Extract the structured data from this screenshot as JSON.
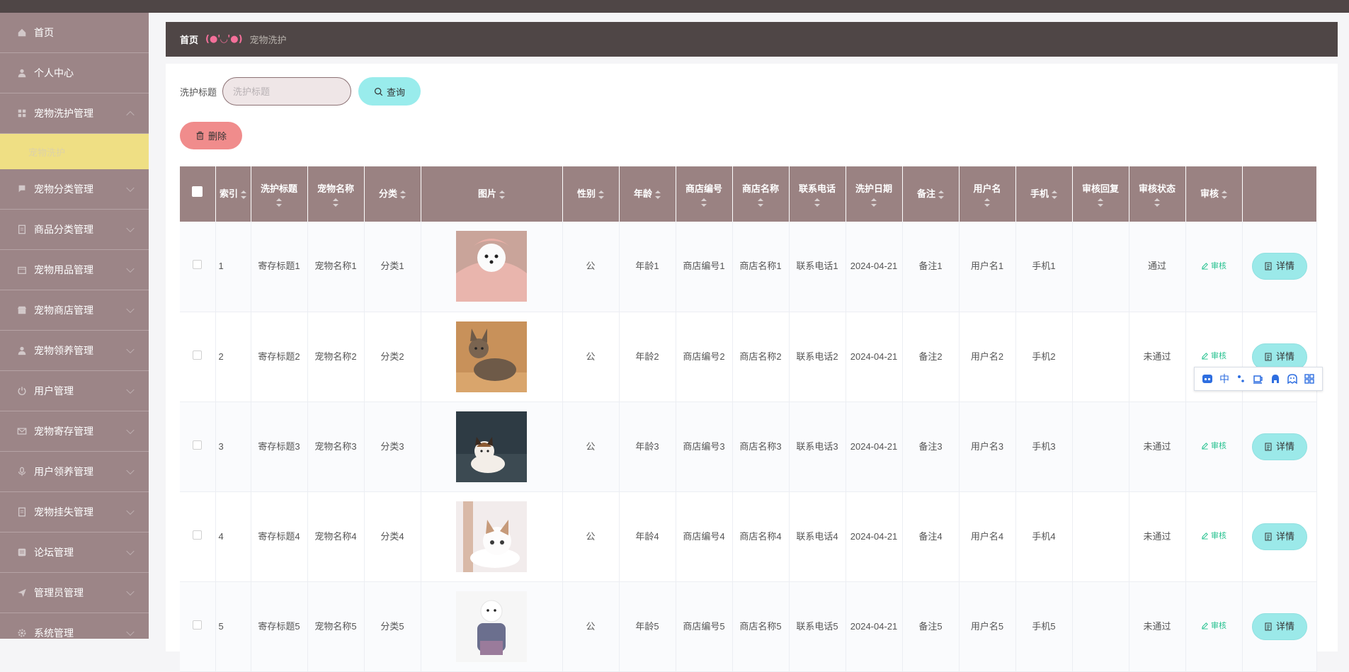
{
  "sidebar": {
    "items": [
      {
        "label": "首页",
        "icon": "home-icon",
        "has_arrow": false
      },
      {
        "label": "个人中心",
        "icon": "user-icon",
        "has_arrow": false
      },
      {
        "label": "宠物洗护管理",
        "icon": "grid-icon",
        "has_arrow": true,
        "expanded": true
      },
      {
        "label": "宠物分类管理",
        "icon": "flag-icon",
        "has_arrow": true
      },
      {
        "label": "商品分类管理",
        "icon": "doc-icon",
        "has_arrow": true
      },
      {
        "label": "宠物用品管理",
        "icon": "box-icon",
        "has_arrow": true
      },
      {
        "label": "宠物商店管理",
        "icon": "shop-icon",
        "has_arrow": true
      },
      {
        "label": "宠物领养管理",
        "icon": "user-icon",
        "has_arrow": true
      },
      {
        "label": "用户管理",
        "icon": "power-icon",
        "has_arrow": true
      },
      {
        "label": "宠物寄存管理",
        "icon": "mail-icon",
        "has_arrow": true
      },
      {
        "label": "用户领养管理",
        "icon": "mic-icon",
        "has_arrow": true
      },
      {
        "label": "宠物挂失管理",
        "icon": "doc-icon",
        "has_arrow": true
      },
      {
        "label": "论坛管理",
        "icon": "list-icon",
        "has_arrow": true
      },
      {
        "label": "管理员管理",
        "icon": "send-icon",
        "has_arrow": true
      },
      {
        "label": "系统管理",
        "icon": "gear-icon",
        "has_arrow": true
      }
    ],
    "active_sub": "宠物洗护"
  },
  "breadcrumb": {
    "home": "首页",
    "separator": "(●'◡'●)",
    "current": "宠物洗护"
  },
  "search": {
    "label": "洗护标题",
    "placeholder": "洗护标题",
    "value": "",
    "button": "查询"
  },
  "actions": {
    "delete": "删除"
  },
  "table": {
    "columns": [
      "索引",
      "洗护标题",
      "宠物名称",
      "分类",
      "图片",
      "性别",
      "年龄",
      "商店编号",
      "商店名称",
      "联系电话",
      "洗护日期",
      "备注",
      "用户名",
      "手机",
      "审核回复",
      "审核状态",
      "审核",
      ""
    ],
    "rows": [
      {
        "index": "1",
        "title": "寄存标题1",
        "pet": "宠物名称1",
        "category": "分类1",
        "image": "white-dog",
        "gender": "公",
        "age": "年龄1",
        "shop_no": "商店编号1",
        "shop_name": "商店名称1",
        "phone": "联系电话1",
        "date": "2024-04-21",
        "note": "备注1",
        "username": "用户名1",
        "mobile": "手机1",
        "reply": "",
        "status": "通过",
        "audit": "审核",
        "detail": "详情"
      },
      {
        "index": "2",
        "title": "寄存标题2",
        "pet": "宠物名称2",
        "category": "分类2",
        "image": "tabby-cat",
        "gender": "公",
        "age": "年龄2",
        "shop_no": "商店编号2",
        "shop_name": "商店名称2",
        "phone": "联系电话2",
        "date": "2024-04-21",
        "note": "备注2",
        "username": "用户名2",
        "mobile": "手机2",
        "reply": "",
        "status": "未通过",
        "audit": "审核",
        "detail": "详情"
      },
      {
        "index": "3",
        "title": "寄存标题3",
        "pet": "宠物名称3",
        "category": "分类3",
        "image": "calico-cat",
        "gender": "公",
        "age": "年龄3",
        "shop_no": "商店编号3",
        "shop_name": "商店名称3",
        "phone": "联系电话3",
        "date": "2024-04-21",
        "note": "备注3",
        "username": "用户名3",
        "mobile": "手机3",
        "reply": "",
        "status": "未通过",
        "audit": "审核",
        "detail": "详情"
      },
      {
        "index": "4",
        "title": "寄存标题4",
        "pet": "宠物名称4",
        "category": "分类4",
        "image": "white-cat",
        "gender": "公",
        "age": "年龄4",
        "shop_no": "商店编号4",
        "shop_name": "商店名称4",
        "phone": "联系电话4",
        "date": "2024-04-21",
        "note": "备注4",
        "username": "用户名4",
        "mobile": "手机4",
        "reply": "",
        "status": "未通过",
        "audit": "审核",
        "detail": "详情"
      },
      {
        "index": "5",
        "title": "寄存标题5",
        "pet": "宠物名称5",
        "category": "分类5",
        "image": "poodle",
        "gender": "公",
        "age": "年龄5",
        "shop_no": "商店编号5",
        "shop_name": "商店名称5",
        "phone": "联系电话5",
        "date": "2024-04-21",
        "note": "备注5",
        "username": "用户名5",
        "mobile": "手机5",
        "reply": "",
        "status": "未通过",
        "audit": "审核",
        "detail": "详情"
      }
    ]
  },
  "ime_toolbar": {
    "lang": "中"
  },
  "colors": {
    "sidebar": "#9c8587",
    "header": "#4f4646",
    "table_header": "#9a8282",
    "accent": "#99ecec",
    "danger": "#f08c8c",
    "active_sub": "#efdf84"
  }
}
